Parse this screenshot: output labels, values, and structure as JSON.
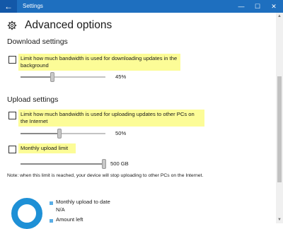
{
  "window": {
    "title": "Settings",
    "back_glyph": "←",
    "minimize_glyph": "—",
    "maximize_glyph": "☐",
    "close_glyph": "✕"
  },
  "page": {
    "icon": "gear-icon",
    "title": "Advanced options"
  },
  "download": {
    "heading": "Download settings",
    "checkbox_label": "Limit how much bandwidth is used for downloading updates in the background",
    "checked": false,
    "slider_value": 45,
    "slider_label": "45%"
  },
  "upload": {
    "heading": "Upload settings",
    "bandwidth_label": "Limit how much bandwidth is used for uploading updates to other PCs on the Internet",
    "bandwidth_checked": false,
    "bandwidth_slider_value": 50,
    "bandwidth_slider_label": "50%",
    "monthly_label": "Monthly upload limit",
    "monthly_checked": false,
    "monthly_slider_fraction": 1.0,
    "monthly_slider_label": "500 GB"
  },
  "note": "Note: when this limit is reached, your device will stop uploading to other PCs on the Internet.",
  "usage": {
    "monthly_label": "Monthly upload to date",
    "monthly_value": "N/A",
    "amount_left_label": "Amount left"
  },
  "colors": {
    "titlebar": "#1e6fbf",
    "highlight": "#fcfc97",
    "accent": "#1e90d6"
  }
}
